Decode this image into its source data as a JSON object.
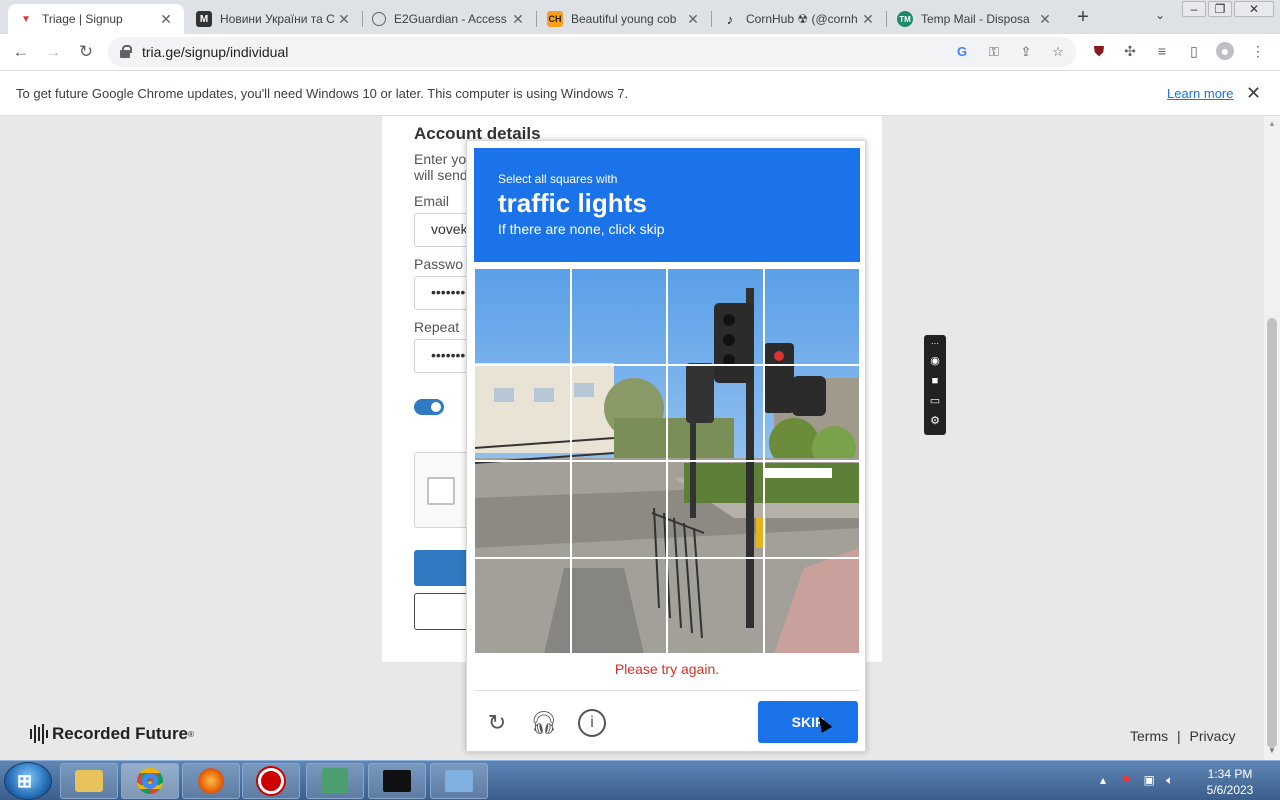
{
  "tabs": [
    {
      "title": "Triage | Signup",
      "icon": "triage-icon",
      "active": true
    },
    {
      "title": "Новини України та С",
      "icon": "m-news-icon"
    },
    {
      "title": "E2Guardian - Access",
      "icon": "globe-icon"
    },
    {
      "title": "Beautiful young cob",
      "icon": "ch-icon"
    },
    {
      "title": "CornHub ☢ (@cornh",
      "icon": "tiktok-icon"
    },
    {
      "title": "Temp Mail - Disposa",
      "icon": "tempmail-icon"
    }
  ],
  "address_bar": {
    "url": "tria.ge/signup/individual"
  },
  "infobar": {
    "message": "To get future Google Chrome updates, you'll need Windows 10 or later. This computer is using Windows 7.",
    "learn_more": "Learn more"
  },
  "form": {
    "title": "Account details",
    "desc_line1": "Enter yo",
    "desc_line2": "will send",
    "email_label": "Email",
    "email_value": "vovek",
    "password_label": "Passwo",
    "password_value": "••••••••",
    "repeat_label": "Repeat",
    "repeat_value": "••••••••"
  },
  "footer": {
    "brand": "Recorded Future",
    "terms": "Terms",
    "separator": "|",
    "privacy": "Privacy"
  },
  "captcha": {
    "prompt_line1": "Select all squares with",
    "prompt_target": "traffic lights",
    "prompt_line3": "If there are none, click skip",
    "error": "Please try again.",
    "skip_label": "SKIP"
  },
  "taskbar": {
    "time": "1:34 PM",
    "date": "5/6/2023"
  },
  "colors": {
    "accent": "#1a73e8",
    "brand_blue": "#2f7ac0",
    "error": "#d93025"
  }
}
